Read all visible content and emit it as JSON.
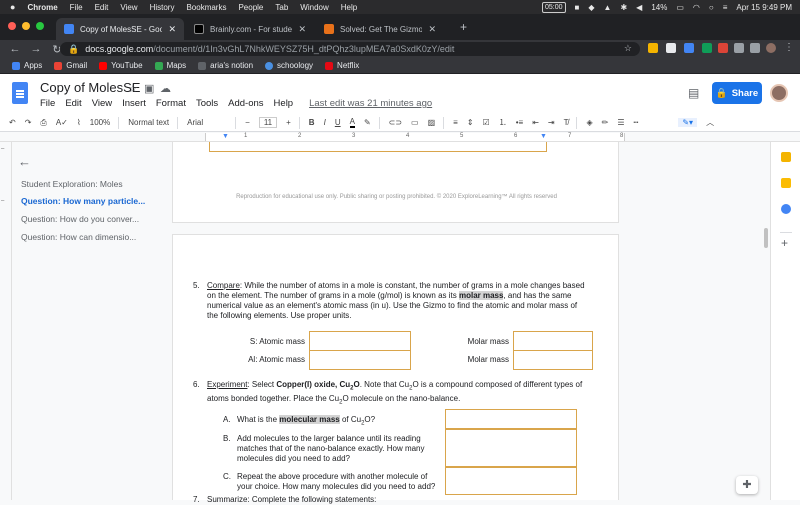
{
  "mac_menu": {
    "app": "Chrome",
    "items": [
      "File",
      "Edit",
      "View",
      "History",
      "Bookmarks",
      "People",
      "Tab",
      "Window",
      "Help"
    ],
    "time_box": "05:00",
    "battery": "14%",
    "clock": "Apr 15  9:49 PM"
  },
  "tabs": [
    {
      "title": "Copy of MolesSE - Google Doc",
      "active": true,
      "color": "#4285f4"
    },
    {
      "title": "Brainly.com - For students. By",
      "active": false,
      "color": "#000000"
    },
    {
      "title": "Solved: Get The Gizmo Ready",
      "active": false,
      "color": "#e8711a"
    }
  ],
  "address": {
    "host": "docs.google.com",
    "path": "/document/d/1In3vGhL7NhkWEYSZ75H_dtPQhz3lupMEA7a0SxdK0zY/edit"
  },
  "bookmarks": [
    {
      "label": "Apps",
      "color": "#4285f4"
    },
    {
      "label": "Gmail",
      "color": "#ea4335"
    },
    {
      "label": "YouTube",
      "color": "#ff0000"
    },
    {
      "label": "Maps",
      "color": "#34a853"
    },
    {
      "label": "aria's notion",
      "color": "#5f6368"
    },
    {
      "label": "schoology",
      "color": "#4a90e2"
    },
    {
      "label": "Netflix",
      "color": "#e50914"
    }
  ],
  "doc": {
    "title": "Copy of MolesSE",
    "menus": [
      "File",
      "Edit",
      "View",
      "Insert",
      "Format",
      "Tools",
      "Add-ons",
      "Help"
    ],
    "last_edit": "Last edit was 21 minutes ago",
    "share": "Share"
  },
  "toolbar": {
    "zoom": "100%",
    "style": "Normal text",
    "font": "Arial",
    "size": "11"
  },
  "outline": {
    "items": [
      {
        "label": "Student Exploration: Moles",
        "active": false
      },
      {
        "label": "Question: How many particle...",
        "active": true
      },
      {
        "label": "Question: How do you conver...",
        "active": false
      },
      {
        "label": "Question: How can dimensio...",
        "active": false
      }
    ]
  },
  "ruler_numbers": [
    "1",
    "2",
    "3",
    "4",
    "5",
    "6",
    "7",
    "8"
  ],
  "page": {
    "footer": "Reproduction for educational use only. Public sharing or posting prohibited. © 2020 ExploreLearning™ All rights reserved",
    "q5": {
      "num": "5.",
      "word": "Compare",
      "line1": ": While the number of atoms in a mole is constant, the number of grams in a mole changes based",
      "line2a": "on the element. The number of grams in a mole (g/mol) is known as its ",
      "line2b": "molar mass",
      "line2c": ", and has the same",
      "line3": "numerical value as an element's atomic mass (in u). Use the Gizmo to find the atomic and molar mass of",
      "line4": "the following elements. Use proper units.",
      "s_atomic": "S: Atomic mass",
      "al_atomic": "Al: Atomic mass",
      "molar1": "Molar mass",
      "molar2": "Molar mass"
    },
    "q6": {
      "num": "6.",
      "word": "Experiment",
      "a": ": Select ",
      "compound": "Copper(I) oxide, Cu",
      "b": ". Note that Cu",
      "c": "O is a compound composed of different types of",
      "line2a": "atoms bonded together. Place the Cu",
      "line2b": "O molecule on the nano-balance.",
      "sub2": "2",
      "subO": "O"
    },
    "qa": {
      "letter": "A.",
      "t1": "What is the ",
      "t2": "molecular mass",
      "t3": " of Cu",
      "t4": "O?"
    },
    "qb": {
      "letter": "B.",
      "l1": "Add molecules to the larger balance until its reading",
      "l2": "matches that of the nano-balance exactly. How many",
      "l3": "molecules did you need to add?"
    },
    "qc": {
      "letter": "C.",
      "l1": "Repeat the above procedure with another molecule of",
      "l2": "your choice. How many molecules did you need to add?"
    },
    "q7": {
      "num": "7.",
      "text": "Summarize: Complete the following statements:"
    }
  }
}
